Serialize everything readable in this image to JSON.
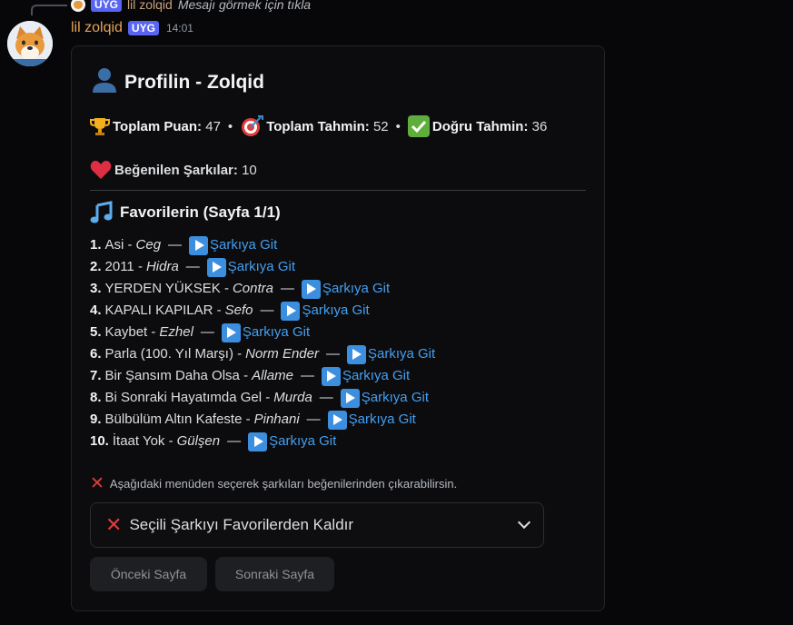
{
  "reply": {
    "tag": "UYG",
    "name": "lil zolqid",
    "text": "Mesajı görmek için tıkla"
  },
  "message": {
    "username": "lil zolqid",
    "tag": "UYG",
    "time": "14:01"
  },
  "embed": {
    "title": "Profilin - Zolqid",
    "stats": [
      {
        "icon": "trophy-icon",
        "label": "Toplam Puan:",
        "value": "47"
      },
      {
        "icon": "target-icon",
        "label": "Toplam Tahmin:",
        "value": "52"
      },
      {
        "icon": "check-icon",
        "label": "Doğru Tahmin:",
        "value": "36"
      }
    ],
    "separator": "•",
    "liked": {
      "icon": "heart-icon",
      "label": "Beğenilen Şarkılar:",
      "value": "10"
    },
    "favorites_title": "Favorilerin (Sayfa 1/1)",
    "songs": [
      {
        "num": "1.",
        "title": "Asi -",
        "artist": "Ceg",
        "link": "Şarkıya Git"
      },
      {
        "num": "2.",
        "title": "2011 -",
        "artist": "Hidra",
        "link": "Şarkıya Git"
      },
      {
        "num": "3.",
        "title": "YERDEN YÜKSEK -",
        "artist": "Contra",
        "link": "Şarkıya Git"
      },
      {
        "num": "4.",
        "title": "KAPALI KAPILAR -",
        "artist": "Sefo",
        "link": "Şarkıya Git"
      },
      {
        "num": "5.",
        "title": "Kaybet -",
        "artist": "Ezhel",
        "link": "Şarkıya Git"
      },
      {
        "num": "6.",
        "title": "Parla (100. Yıl Marşı) -",
        "artist": "Norm Ender",
        "link": "Şarkıya Git"
      },
      {
        "num": "7.",
        "title": "Bir Şansım Daha Olsa -",
        "artist": "Allame",
        "link": "Şarkıya Git"
      },
      {
        "num": "8.",
        "title": "Bi Sonraki Hayatımda Gel -",
        "artist": "Murda",
        "link": "Şarkıya Git"
      },
      {
        "num": "9.",
        "title": "Bülbülüm Altın Kafeste -",
        "artist": "Pinhani",
        "link": "Şarkıya Git"
      },
      {
        "num": "10.",
        "title": "İtaat Yok -",
        "artist": "Gülşen",
        "link": "Şarkıya Git"
      }
    ],
    "dash": "—",
    "footer_note": "Aşağıdaki menüden seçerek şarkıları beğenilerinden çıkarabilirsin.",
    "select_placeholder": "Seçili Şarkıyı Favorilerden Kaldır",
    "prev_button": "Önceki Sayfa",
    "next_button": "Sonraki Sayfa"
  },
  "colors": {
    "username": "#e3a354",
    "tag_bg": "#5865f2",
    "link": "#449ff0",
    "embed_bg": "#0c0c0e"
  }
}
